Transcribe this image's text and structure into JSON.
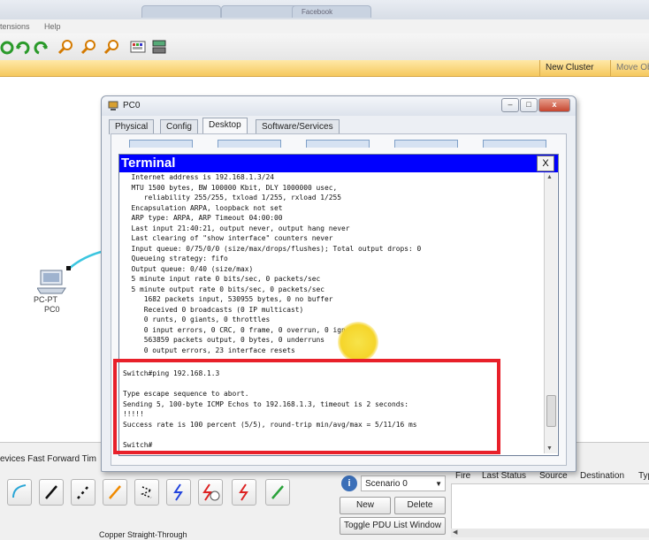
{
  "browser": {
    "tab_text": "Facebook"
  },
  "menu": {
    "items": [
      "tensions",
      "Help"
    ]
  },
  "cluster_bar": {
    "new_cluster": "New Cluster",
    "move_object": "Move Ob"
  },
  "workspace": {
    "pc_type": "PC-PT",
    "pc_name": "PC0"
  },
  "pc_window": {
    "title": "PC0",
    "tabs": [
      "Physical",
      "Config",
      "Desktop",
      "Software/Services"
    ],
    "active_tab": "Desktop"
  },
  "terminal": {
    "title": "Terminal",
    "close": "X",
    "lines": [
      "  Internet address is 192.168.1.3/24",
      "  MTU 1500 bytes, BW 100000 Kbit, DLY 1000000 usec,",
      "     reliability 255/255, txload 1/255, rxload 1/255",
      "  Encapsulation ARPA, loopback not set",
      "  ARP type: ARPA, ARP Timeout 04:00:00",
      "  Last input 21:40:21, output never, output hang never",
      "  Last clearing of \"show interface\" counters never",
      "  Input queue: 0/75/0/0 (size/max/drops/flushes); Total output drops: 0",
      "  Queueing strategy: fifo",
      "  Output queue: 0/40 (size/max)",
      "  5 minute input rate 0 bits/sec, 0 packets/sec",
      "  5 minute output rate 0 bits/sec, 0 packets/sec",
      "     1682 packets input, 530955 bytes, 0 no buffer",
      "     Received 0 broadcasts (0 IP multicast)",
      "     0 runts, 0 giants, 0 throttles",
      "     0 input errors, 0 CRC, 0 frame, 0 overrun, 0 ignored",
      "     563859 packets output, 0 bytes, 0 underruns",
      "     0 output errors, 23 interface resets",
      "Switch#ping 192.168.1.3",
      "",
      "Type escape sequence to abort.",
      "Sending 5, 100-byte ICMP Echos to 192.168.1.3, timeout is 2 seconds:",
      "!!!!!",
      "Success rate is 100 percent (5/5), round-trip min/avg/max = 5/11/16 ms",
      "",
      "Switch#"
    ]
  },
  "bottom": {
    "device_label": "evices  Fast Forward Tim",
    "cable_label": "Copper Straight-Through",
    "scenario": "Scenario 0",
    "new_btn": "New",
    "delete_btn": "Delete",
    "toggle_btn": "Toggle PDU List Window",
    "event_cols": [
      "Fire",
      "Last Status",
      "Source",
      "Destination",
      "Typ"
    ]
  },
  "colors": {
    "terminal_title": "#0000ff",
    "highlight": "#e8202a",
    "cluster_bar": "#f5c85e"
  }
}
